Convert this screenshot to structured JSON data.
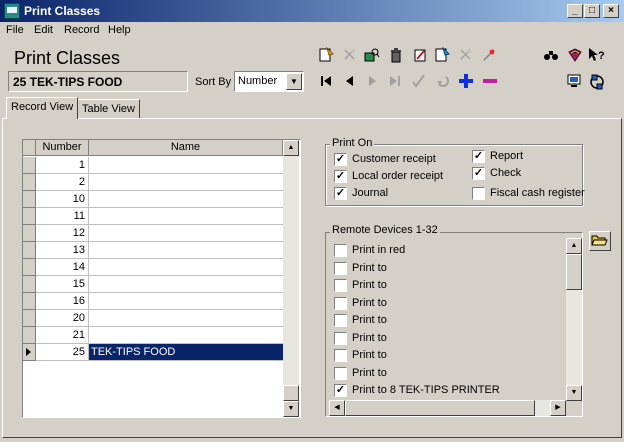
{
  "window": {
    "title": "Print Classes"
  },
  "menu": [
    "File",
    "Edit",
    "Record",
    "Help"
  ],
  "form": {
    "title": "Print Classes",
    "current_record": "25 TEK-TIPS FOOD"
  },
  "sort": {
    "label": "Sort By",
    "value": "Number"
  },
  "tabs": [
    {
      "label": "Record View",
      "active": true
    },
    {
      "label": "Table View",
      "active": false
    }
  ],
  "grid": {
    "columns": [
      "Number",
      "Name"
    ],
    "rows": [
      {
        "number": "1",
        "name": ""
      },
      {
        "number": "2",
        "name": ""
      },
      {
        "number": "10",
        "name": ""
      },
      {
        "number": "11",
        "name": ""
      },
      {
        "number": "12",
        "name": ""
      },
      {
        "number": "13",
        "name": ""
      },
      {
        "number": "14",
        "name": ""
      },
      {
        "number": "15",
        "name": ""
      },
      {
        "number": "16",
        "name": ""
      },
      {
        "number": "20",
        "name": ""
      },
      {
        "number": "21",
        "name": ""
      },
      {
        "number": "25",
        "name": "TEK-TIPS FOOD",
        "selected": true
      }
    ]
  },
  "print_on": {
    "label": "Print On",
    "options": [
      {
        "label": "Customer receipt",
        "checked": true
      },
      {
        "label": "Local order receipt",
        "checked": true
      },
      {
        "label": "Journal",
        "checked": true
      },
      {
        "label": "Report",
        "checked": true
      },
      {
        "label": "Check",
        "checked": true
      },
      {
        "label": "Fiscal cash register",
        "checked": false
      }
    ]
  },
  "remote_devices": {
    "label": "Remote Devices 1-32",
    "items": [
      {
        "label": "Print in red",
        "checked": false
      },
      {
        "label": "Print to",
        "checked": false
      },
      {
        "label": "Print to",
        "checked": false
      },
      {
        "label": "Print to",
        "checked": false
      },
      {
        "label": "Print to",
        "checked": false
      },
      {
        "label": "Print to",
        "checked": false
      },
      {
        "label": "Print to",
        "checked": false
      },
      {
        "label": "Print to",
        "checked": false
      },
      {
        "label": "Print to 8  TEK-TIPS PRINTER",
        "checked": true
      }
    ]
  },
  "colors": {
    "title_bar": "#0a246a",
    "selection": "#0a246a",
    "face": "#d4d0c8"
  }
}
